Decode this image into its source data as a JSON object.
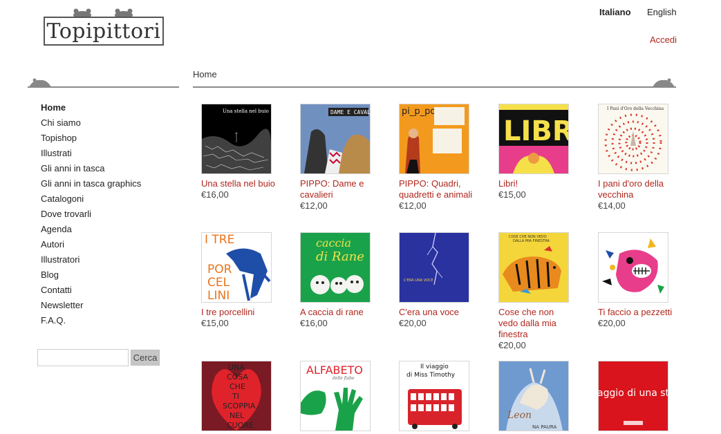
{
  "site": {
    "logo_text": "Topipittori",
    "languages": [
      {
        "label": "Italiano",
        "active": true
      },
      {
        "label": "English",
        "active": false
      }
    ],
    "login_label": "Accedi"
  },
  "breadcrumb": "Home",
  "sidebar": {
    "items": [
      {
        "label": "Home",
        "current": true
      },
      {
        "label": "Chi siamo"
      },
      {
        "label": "Topishop"
      },
      {
        "label": "Illustrati"
      },
      {
        "label": "Gli anni in tasca"
      },
      {
        "label": "Gli anni in tasca graphics"
      },
      {
        "label": "Catalogoni"
      },
      {
        "label": "Dove trovarli"
      },
      {
        "label": "Agenda"
      },
      {
        "label": "Autori"
      },
      {
        "label": "Illustratori"
      },
      {
        "label": "Blog"
      },
      {
        "label": "Contatti"
      },
      {
        "label": "Newsletter"
      },
      {
        "label": "F.A.Q."
      }
    ],
    "search_button": "Cerca"
  },
  "products": [
    {
      "title": "Una stella nel buio",
      "price": "€16,00",
      "cover_text": "Una stella nel buio"
    },
    {
      "title": "PIPPO: Dame e cavalieri",
      "price": "€12,00",
      "cover_text": "DAME E CAVALIERI"
    },
    {
      "title": "PIPPO: Quadri, quadretti e animali",
      "price": "€12,00",
      "cover_text": "pi_p_po.."
    },
    {
      "title": "Libri!",
      "price": "€15,00",
      "cover_text": "LIBRI"
    },
    {
      "title": "I pani d'oro della vecchina",
      "price": "€14,00",
      "cover_text": "I Pani d'Oro della Vecchina"
    },
    {
      "title": "I tre porcellini",
      "price": "€15,00",
      "cover_text": "I TRE PORCELLINI"
    },
    {
      "title": "A caccia di rane",
      "price": "€16,00",
      "cover_text": "caccia di Rane"
    },
    {
      "title": "C'era una voce",
      "price": "€20,00",
      "cover_text": "C'ERA UNA VOCE"
    },
    {
      "title": "Cose che non vedo dalla mia finestra",
      "price": "€20,00",
      "cover_text": "COSE CHE NON VEDO DALLA MIA FINESTRA"
    },
    {
      "title": "Ti faccio a pezzetti",
      "price": "€20,00",
      "cover_text": ""
    },
    {
      "title": "",
      "price": "",
      "cover_text": "UNA COSA CHE TI SCOPPIA NEL CUORE"
    },
    {
      "title": "",
      "price": "",
      "cover_text": "ALFABETO delle fiabe"
    },
    {
      "title": "",
      "price": "",
      "cover_text": "Il viaggio di Miss Timothy"
    },
    {
      "title": "",
      "price": "",
      "cover_text": "NA PAURA"
    },
    {
      "title": "",
      "price": "",
      "cover_text": "aggio di una ste"
    }
  ]
}
